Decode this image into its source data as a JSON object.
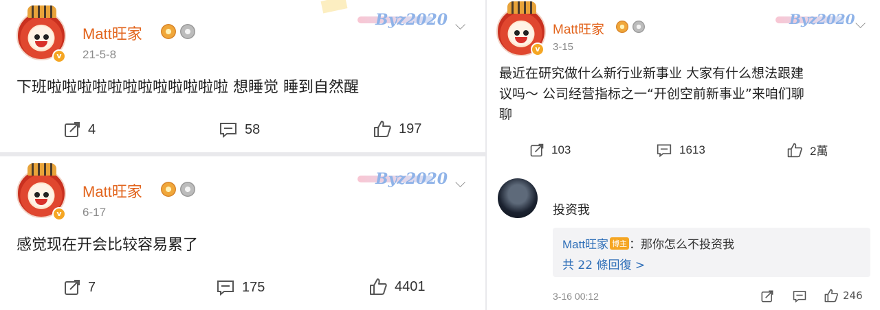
{
  "posts": [
    {
      "author": "Matt旺家",
      "date": "21-5-8",
      "stamp": "Byz2020",
      "text": "下班啦啦啦啦啦啦啦啦啦啦啦啦 想睡觉 睡到自然醒",
      "reposts": "4",
      "comments": "58",
      "likes": "197"
    },
    {
      "author": "Matt旺家",
      "date": "6-17",
      "stamp": "Byz2020",
      "text": "感觉现在开会比较容易累了",
      "reposts": "7",
      "comments": "175",
      "likes": "4401"
    },
    {
      "author": "Matt旺家",
      "date": "3-15",
      "stamp": "Byz2020",
      "text_lines": [
        "最近在研究做什么新行业新事业 大家有什么想法跟建",
        "议吗～ 公司经营指标之一“开创空前新事业”来咱们聊",
        "聊"
      ],
      "reposts": "103",
      "comments": "1613",
      "likes": "2萬"
    }
  ],
  "comment": {
    "author": "投资我",
    "reply_author": "Matt旺家",
    "reply_tag": "博主",
    "reply_text": "：那你怎么不投资我",
    "reply_count": "共 22 條回復 >",
    "date": "3-16 00:12",
    "likes": "246"
  },
  "colors": {
    "author_name": "#e2651e",
    "link": "#2f6fb8",
    "badge": "#f5a623"
  },
  "icons": [
    "repost-icon",
    "comment-icon",
    "like-icon",
    "chevron-down-icon",
    "verified-badge-icon",
    "medal-icon"
  ]
}
